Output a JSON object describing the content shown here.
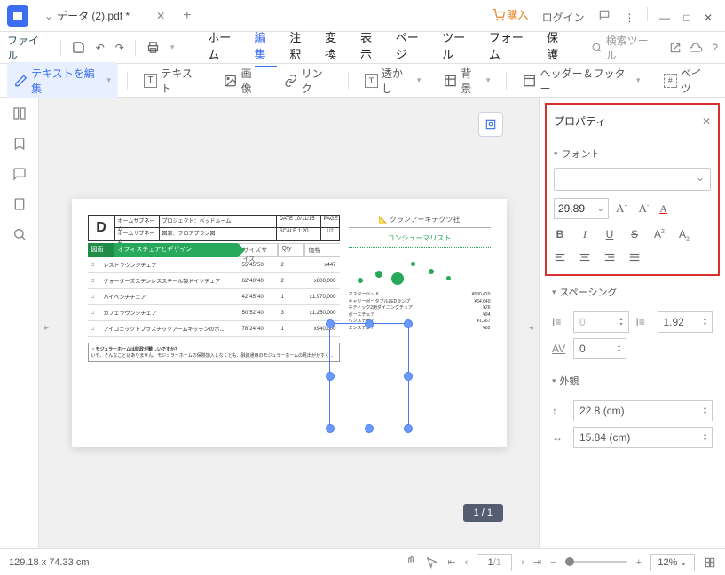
{
  "titlebar": {
    "tab_title": "データ (2).pdf *",
    "buy": "購入",
    "login": "ログイン"
  },
  "menubar": {
    "file": "ファイル",
    "items": [
      "ホーム",
      "編集",
      "注釈",
      "変換",
      "表示",
      "ページ",
      "ツール",
      "フォーム",
      "保護"
    ],
    "active_index": 1,
    "search_placeholder": "検索ツール"
  },
  "toolbar": {
    "edit_text": "テキストを編集",
    "text": "テキスト",
    "image": "画像",
    "link": "リンク",
    "watermark": "透かし",
    "background": "背景",
    "header_footer": "ヘッダー＆フッター",
    "bates": "ベイツ"
  },
  "page": {
    "header": {
      "logo": "D",
      "row1": {
        "l1": "ホームサブネーム",
        "l2": "プロジェクト：ベッドルーム",
        "l3": "DATE 10/11/15",
        "l4": "PAGE"
      },
      "row2": {
        "l1": "ホームサブネーム",
        "l2": "図案：フロアプラン図",
        "l3": "SCALE 1:20",
        "l4": "1/2"
      }
    },
    "green_header": {
      "g1": "図面",
      "g2": "オフィスチェアとデザイン",
      "g3": "サイズサイズ",
      "g4": "Qty",
      "g5": "価格"
    },
    "rows": [
      {
        "c0": "□",
        "c1": "レストラウンジチェア",
        "c2": "55\"45\"50",
        "c3": "2",
        "c4": "x447"
      },
      {
        "c0": "□",
        "c1": "クォーターズステンレススチール製ドイツチェア",
        "c2": "62\"40\"40",
        "c3": "2",
        "c4": "x800,000"
      },
      {
        "c0": "□",
        "c1": "ハイベンチチェア",
        "c2": "42\"45\"40",
        "c3": "1",
        "c4": "x1,970,000"
      },
      {
        "c0": "□",
        "c1": "カフェラウンジチェア",
        "c2": "50\"52\"40",
        "c3": "3",
        "c4": "x1,250,000"
      },
      {
        "c0": "□",
        "c1": "アイコニックトプラスチックアームキッチンのボ...",
        "c2": "78\"24\"40",
        "c3": "1",
        "c4": "x940,000"
      }
    ],
    "note_title": "・モジュラーホームは財政が難しいですか？",
    "note_body": "いや、そんなことはありません。モジュラーホームの保険加入しなくとも、融資通用のモジュラーホームの見出がかすく...",
    "company": "クランアーキテクツ社",
    "consumer": "コンシューマリスト",
    "items": [
      {
        "n": "マスターベッド",
        "v": "¥530,420"
      },
      {
        "n": "キャリーボータブルLEDランプ",
        "v": "¥64,640"
      },
      {
        "n": "ネティック2用ダイニングチェア",
        "v": "¥26"
      },
      {
        "n": "ボーエチェア",
        "v": "¥94"
      },
      {
        "n": "ベンスチェア",
        "v": "¥1,267"
      },
      {
        "n": "ヌンスチェア",
        "v": "¥82"
      }
    ]
  },
  "page_indicator": "1 / 1",
  "properties": {
    "title": "プロパティ",
    "font_section": "フォント",
    "font_size": "29.89",
    "spacing_section": "スペーシング",
    "char_spacing": "0",
    "line_spacing": "1.92",
    "av_spacing": "0",
    "appearance_section": "外観",
    "width": "22.8 (cm)",
    "height": "15.84 (cm)"
  },
  "statusbar": {
    "coords": "129.18 x 74.33 cm",
    "page_current": "1",
    "page_total": "/1",
    "zoom": "12%"
  }
}
